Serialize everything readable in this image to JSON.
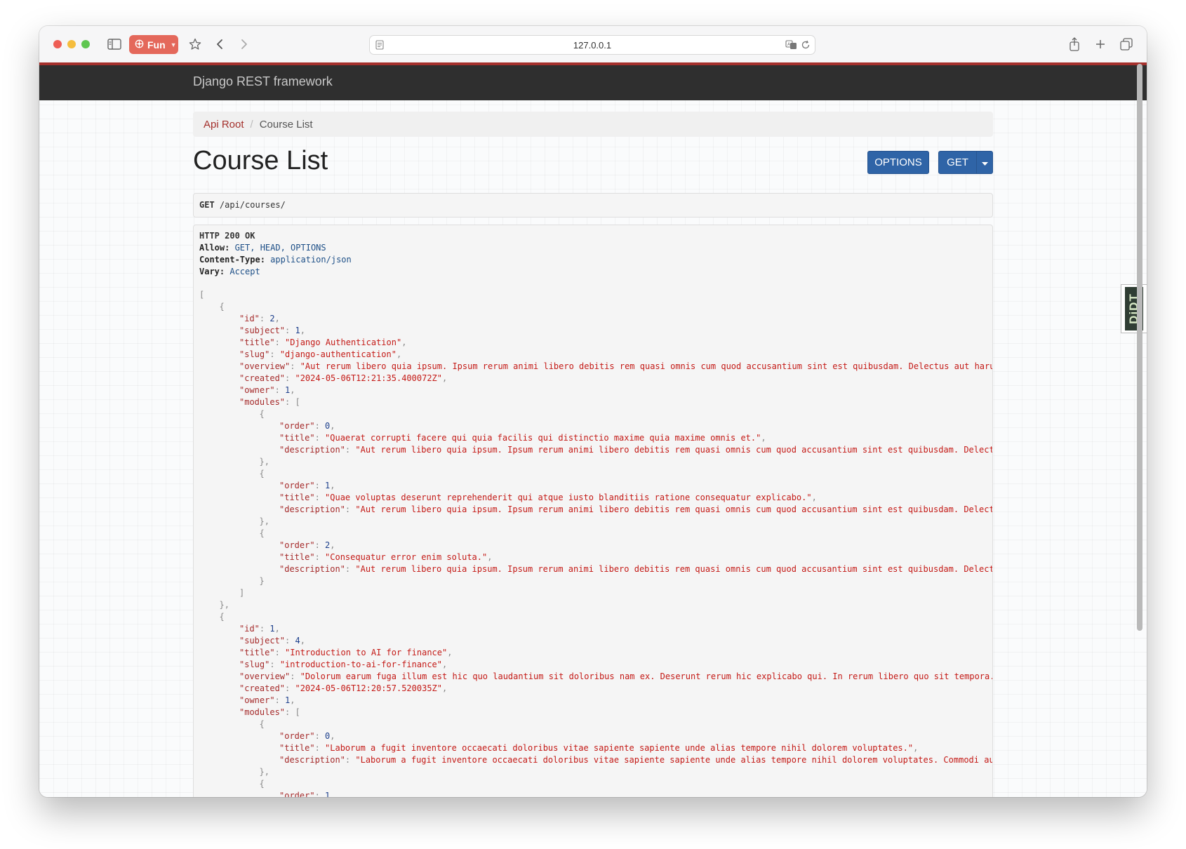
{
  "browser": {
    "profile_label": "Fun",
    "url": "127.0.0.1",
    "icons": [
      "sidebar-icon",
      "star-icon",
      "back-icon",
      "forward-icon",
      "reader-icon",
      "translate-icon",
      "reload-icon",
      "share-icon",
      "new-tab-icon",
      "tabs-overview-icon"
    ]
  },
  "navbar": {
    "brand": "Django REST framework"
  },
  "breadcrumb": {
    "root": "Api Root",
    "separator": "/",
    "current": "Course List"
  },
  "page": {
    "title": "Course List"
  },
  "actions": {
    "options_label": "OPTIONS",
    "get_label": "GET"
  },
  "request": {
    "method": "GET",
    "path": " /api/courses/"
  },
  "response": {
    "status": "HTTP 200 OK",
    "headers": [
      {
        "name": "Allow:",
        "value": " GET, HEAD, OPTIONS"
      },
      {
        "name": "Content-Type:",
        "value": " application/json"
      },
      {
        "name": "Vary:",
        "value": " Accept"
      }
    ],
    "body_lines": [
      {
        "indent": 0,
        "text": "["
      },
      {
        "indent": 1,
        "text": "{"
      },
      {
        "indent": 2,
        "key": "id",
        "num": "2",
        "tail": ","
      },
      {
        "indent": 2,
        "key": "subject",
        "num": "1",
        "tail": ","
      },
      {
        "indent": 2,
        "key": "title",
        "str": "\"Django Authentication\"",
        "tail": ","
      },
      {
        "indent": 2,
        "key": "slug",
        "str": "\"django-authentication\"",
        "tail": ","
      },
      {
        "indent": 2,
        "key": "overview",
        "str": "\"Aut rerum libero quia ipsum. Ipsum rerum animi libero debitis rem quasi omnis cum quod accusantium sint est quibusdam. Delectus aut haru"
      },
      {
        "indent": 2,
        "key": "created",
        "str": "\"2024-05-06T12:21:35.400072Z\"",
        "tail": ","
      },
      {
        "indent": 2,
        "key": "owner",
        "num": "1",
        "tail": ","
      },
      {
        "indent": 2,
        "key": "modules",
        "tail": "["
      },
      {
        "indent": 3,
        "text": "{"
      },
      {
        "indent": 4,
        "key": "order",
        "num": "0",
        "tail": ","
      },
      {
        "indent": 4,
        "key": "title",
        "str": "\"Quaerat corrupti facere qui quia facilis qui distinctio maxime quia maxime omnis et.\"",
        "tail": ","
      },
      {
        "indent": 4,
        "key": "description",
        "str": "\"Aut rerum libero quia ipsum. Ipsum rerum animi libero debitis rem quasi omnis cum quod accusantium sint est quibusdam. Delect"
      },
      {
        "indent": 3,
        "text": "},"
      },
      {
        "indent": 3,
        "text": "{"
      },
      {
        "indent": 4,
        "key": "order",
        "num": "1",
        "tail": ","
      },
      {
        "indent": 4,
        "key": "title",
        "str": "\"Quae voluptas deserunt reprehenderit qui atque iusto blanditiis ratione consequatur explicabo.\"",
        "tail": ","
      },
      {
        "indent": 4,
        "key": "description",
        "str": "\"Aut rerum libero quia ipsum. Ipsum rerum animi libero debitis rem quasi omnis cum quod accusantium sint est quibusdam. Delect"
      },
      {
        "indent": 3,
        "text": "},"
      },
      {
        "indent": 3,
        "text": "{"
      },
      {
        "indent": 4,
        "key": "order",
        "num": "2",
        "tail": ","
      },
      {
        "indent": 4,
        "key": "title",
        "str": "\"Consequatur error enim soluta.\"",
        "tail": ","
      },
      {
        "indent": 4,
        "key": "description",
        "str": "\"Aut rerum libero quia ipsum. Ipsum rerum animi libero debitis rem quasi omnis cum quod accusantium sint est quibusdam. Delect"
      },
      {
        "indent": 3,
        "text": "}"
      },
      {
        "indent": 2,
        "text": "]"
      },
      {
        "indent": 1,
        "text": "},"
      },
      {
        "indent": 1,
        "text": "{"
      },
      {
        "indent": 2,
        "key": "id",
        "num": "1",
        "tail": ","
      },
      {
        "indent": 2,
        "key": "subject",
        "num": "4",
        "tail": ","
      },
      {
        "indent": 2,
        "key": "title",
        "str": "\"Introduction to AI for finance\"",
        "tail": ","
      },
      {
        "indent": 2,
        "key": "slug",
        "str": "\"introduction-to-ai-for-finance\"",
        "tail": ","
      },
      {
        "indent": 2,
        "key": "overview",
        "str": "\"Dolorum earum fuga illum est hic quo laudantium sit doloribus nam ex. Deserunt rerum hic explicabo qui. In rerum libero quo sit tempora."
      },
      {
        "indent": 2,
        "key": "created",
        "str": "\"2024-05-06T12:20:57.520035Z\"",
        "tail": ","
      },
      {
        "indent": 2,
        "key": "owner",
        "num": "1",
        "tail": ","
      },
      {
        "indent": 2,
        "key": "modules",
        "tail": "["
      },
      {
        "indent": 3,
        "text": "{"
      },
      {
        "indent": 4,
        "key": "order",
        "num": "0",
        "tail": ","
      },
      {
        "indent": 4,
        "key": "title",
        "str": "\"Laborum a fugit inventore occaecati doloribus vitae sapiente sapiente unde alias tempore nihil dolorem voluptates.\"",
        "tail": ","
      },
      {
        "indent": 4,
        "key": "description",
        "str": "\"Laborum a fugit inventore occaecati doloribus vitae sapiente sapiente unde alias tempore nihil dolorem voluptates. Commodi au"
      },
      {
        "indent": 3,
        "text": "},"
      },
      {
        "indent": 3,
        "text": "{"
      },
      {
        "indent": 4,
        "key": "order",
        "num": "1"
      }
    ]
  },
  "debug_toolbar": {
    "label": "DjDT"
  }
}
